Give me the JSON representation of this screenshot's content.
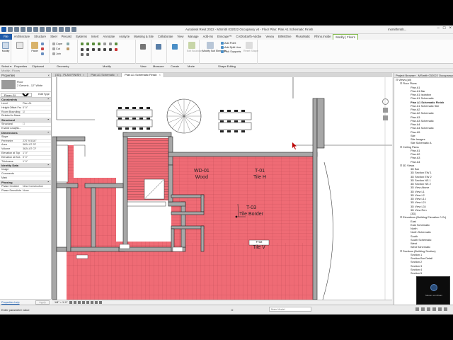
{
  "titlebar": {
    "title": "Autodesk Revit 2022 - MSmith 032022 Occupancy v4 - Floor Plan: Plan A1 Schematic Finish",
    "user": "msmithmbb..."
  },
  "ribbon_tabs": [
    "File",
    "Architecture",
    "Structure",
    "Steel",
    "Precast",
    "Systems",
    "Insert",
    "Annotate",
    "Analyze",
    "Massing & Site",
    "Collaborate",
    "View",
    "Manage",
    "Add-Ins",
    "Enscape™",
    "CADtoEarth-Adobe",
    "Vesea",
    "BIMstOne",
    "PlusoMatic",
    "Rhino.Inside",
    "Modify | Floors"
  ],
  "ribbon": {
    "groups": {
      "select": "Select",
      "properties": "Properties",
      "clipboard": "Clipboard",
      "geometry": "Geometry",
      "modify": "Modify",
      "view": "View",
      "measure": "Measure",
      "create": "Create",
      "mode": "Mode",
      "shape_editing": "Shape Editing"
    },
    "modify_btn": "Modify",
    "paste_btn": "Paste",
    "edit_boundary": "Edit Boundary",
    "modify_sub": "Modify Sub Elements",
    "add_point": "Add Point",
    "add_split_line": "Add Split Line",
    "pick_supports": "Pick Supports",
    "reset_shape": "Reset Shape",
    "cope": "Cope",
    "cut": "Cut",
    "join": "Join"
  },
  "selection_bar": [
    "Select ▾",
    "Properties",
    "Clipboard",
    "Geometry",
    "Modify",
    "View",
    "Measure",
    "Create",
    "Mode",
    "Shape Editing"
  ],
  "options_bar": "Modify | Floors",
  "properties": {
    "header": "Properties",
    "type_family": "Floor",
    "type_name": "2 Generic - 12\" White",
    "instance_selector": "Floors (1)",
    "edit_type": "Edit Type",
    "sections": [
      {
        "name": "Constraints",
        "rows": [
          [
            "Level",
            "Plan A1"
          ],
          [
            "Height Offset Fro...",
            "0' 0\""
          ],
          [
            "Room Bounding",
            "☑"
          ],
          [
            "Related to Mass",
            ""
          ]
        ]
      },
      {
        "name": "Structural",
        "rows": [
          [
            "Structural",
            "☐"
          ],
          [
            "Enable Analytic...",
            ""
          ]
        ]
      },
      {
        "name": "Dimensions",
        "rows": [
          [
            "Slope",
            ""
          ],
          [
            "Perimeter",
            "270' 9 5/16\""
          ],
          [
            "Area",
            "3624.87 SF"
          ],
          [
            "Volume",
            "3624.87 CF"
          ],
          [
            "Elevation at Top",
            "1' 0\""
          ],
          [
            "Elevation at Bot...",
            "0' 0\""
          ],
          [
            "Thickness",
            "1' 0\""
          ]
        ]
      },
      {
        "name": "Identity Data",
        "rows": [
          [
            "Image",
            ""
          ],
          [
            "Comments",
            ""
          ],
          [
            "Mark",
            ""
          ]
        ]
      },
      {
        "name": "Phasing",
        "rows": [
          [
            "Phase Created",
            "New Construction"
          ],
          [
            "Phase Demolished",
            "None"
          ]
        ]
      }
    ],
    "help_link": "Properties help",
    "apply": "Apply"
  },
  "view_tabs": [
    {
      "label": "{3D} - PLAN FINISH",
      "active": false
    },
    {
      "label": "Plan A1 Schematic",
      "active": false
    },
    {
      "label": "Plan A1 Schematic Finish",
      "active": true
    }
  ],
  "canvas": {
    "tags": [
      {
        "code": "WD-01",
        "name": "Wood"
      },
      {
        "code": "T-01",
        "name": "Tile H"
      },
      {
        "code": "T-03",
        "name": "Tile Border"
      },
      {
        "code": "T-02",
        "name": "Tile V"
      }
    ],
    "floor_color": "#ef6b75"
  },
  "view_control": {
    "scale": "1/8\" = 1'-0\""
  },
  "browser": {
    "header": "Project Browser - MSmith 032022 Occupancy...",
    "items": [
      {
        "t": "Views (all)",
        "lvl": 0,
        "tg": "⊟"
      },
      {
        "t": "Floor Plans",
        "lvl": 1,
        "tg": "⊟"
      },
      {
        "t": "Plan A1",
        "lvl": 2
      },
      {
        "t": "Plan A1 Bar",
        "lvl": 2
      },
      {
        "t": "Plan A1 Isolation",
        "lvl": 2
      },
      {
        "t": "Plan A1 Schematic",
        "lvl": 2
      },
      {
        "t": "Plan A1 Schematic Finish",
        "lvl": 2,
        "bold": true
      },
      {
        "t": "Plan A1 Schematic Site",
        "lvl": 2
      },
      {
        "t": "Plan A2",
        "lvl": 2
      },
      {
        "t": "Plan A2 Schematic",
        "lvl": 2
      },
      {
        "t": "Plan A3",
        "lvl": 2
      },
      {
        "t": "Plan A3 Schematic",
        "lvl": 2
      },
      {
        "t": "Plan A4",
        "lvl": 2
      },
      {
        "t": "Plan A4 Schematic",
        "lvl": 2
      },
      {
        "t": "Plan A5",
        "lvl": 2
      },
      {
        "t": "Site",
        "lvl": 2
      },
      {
        "t": "Site Images",
        "lvl": 2
      },
      {
        "t": "Site Schematic A",
        "lvl": 2
      },
      {
        "t": "Ceiling Plans",
        "lvl": 1,
        "tg": "⊟"
      },
      {
        "t": "Plan A1",
        "lvl": 2
      },
      {
        "t": "Plan A2",
        "lvl": 2
      },
      {
        "t": "Plan A3",
        "lvl": 2
      },
      {
        "t": "Plan A4",
        "lvl": 2
      },
      {
        "t": "3D Views",
        "lvl": 1,
        "tg": "⊟"
      },
      {
        "t": "3D Bar",
        "lvl": 2
      },
      {
        "t": "3D Section EW 1",
        "lvl": 2
      },
      {
        "t": "3D Section EW 2",
        "lvl": 2
      },
      {
        "t": "3D Section NS 1",
        "lvl": 2
      },
      {
        "t": "3D Section NS 2",
        "lvl": 2
      },
      {
        "t": "3D View Above",
        "lvl": 2
      },
      {
        "t": "3D View L1",
        "lvl": 2
      },
      {
        "t": "3D View L2",
        "lvl": 2
      },
      {
        "t": "3D View L1-l",
        "lvl": 2
      },
      {
        "t": "3D View L2-l",
        "lvl": 2
      },
      {
        "t": "3D View L3-l",
        "lvl": 2
      },
      {
        "t": "3D View Ren",
        "lvl": 2
      },
      {
        "t": "{3D}",
        "lvl": 2
      },
      {
        "t": "Elevations (Building Elevation 0 Gr)",
        "lvl": 1,
        "tg": "⊟"
      },
      {
        "t": "East",
        "lvl": 2
      },
      {
        "t": "East Schematic",
        "lvl": 2
      },
      {
        "t": "North",
        "lvl": 2
      },
      {
        "t": "North Schematic",
        "lvl": 2
      },
      {
        "t": "South",
        "lvl": 2
      },
      {
        "t": "South Schematic",
        "lvl": 2
      },
      {
        "t": "West",
        "lvl": 2
      },
      {
        "t": "West Schematic",
        "lvl": 2
      },
      {
        "t": "Sections (Building Section)",
        "lvl": 1,
        "tg": "⊟"
      },
      {
        "t": "Section 1",
        "lvl": 2
      },
      {
        "t": "Section Bar Detail",
        "lvl": 2
      },
      {
        "t": "Section 2",
        "lvl": 2
      },
      {
        "t": "Section 3",
        "lvl": 2
      },
      {
        "t": "Section 4",
        "lvl": 2
      },
      {
        "t": "Section 5",
        "lvl": 2
      }
    ]
  },
  "webcam": {
    "caption": "Mason nom/Roan"
  },
  "status": {
    "message": "Enter parameter value",
    "zero": ":0",
    "model": "Main Model"
  }
}
